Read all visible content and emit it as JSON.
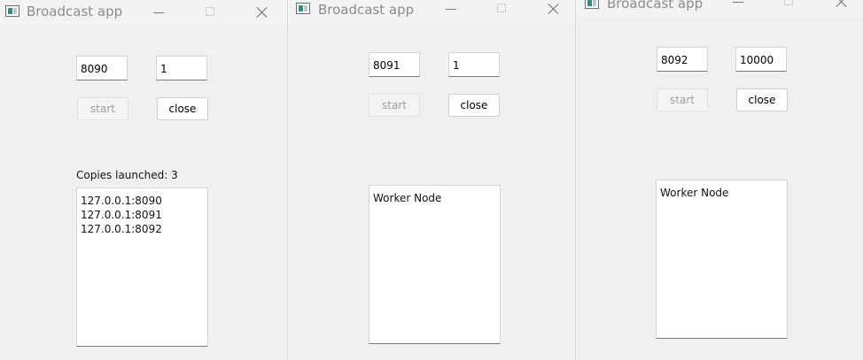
{
  "windows": [
    {
      "title": "Broadcast app",
      "port": "8090",
      "count": "1",
      "start_label": "start",
      "close_label": "close",
      "status_label": "Copies launched: 3",
      "list_items": [
        "127.0.0.1:8090",
        "127.0.0.1:8091",
        "127.0.0.1:8092"
      ]
    },
    {
      "title": "Broadcast app",
      "port": "8091",
      "count": "1",
      "start_label": "start",
      "close_label": "close",
      "list_items": [
        "Worker Node"
      ]
    },
    {
      "title": "Broadcast app",
      "port": "8092",
      "count": "10000",
      "start_label": "start",
      "close_label": "close",
      "list_items": [
        "Worker Node"
      ]
    }
  ],
  "icons": {
    "app": "app-window-icon",
    "minimize": "minimize-icon",
    "maximize": "maximize-icon",
    "close": "close-icon"
  },
  "colors": {
    "window_bg": "#f0f0f0",
    "titlebar_bg": "#f3f3f3",
    "title_text": "#8b8b8b",
    "disabled_text": "#9d9d9d",
    "icon_accent": "#2f8f86"
  }
}
